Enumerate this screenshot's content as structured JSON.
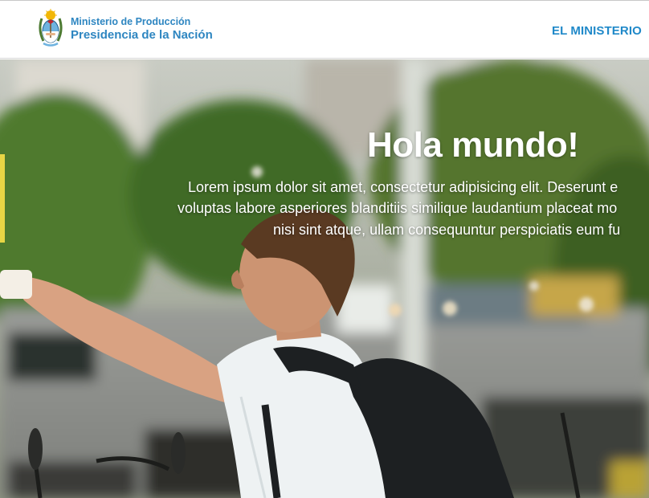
{
  "header": {
    "brand": {
      "line1": "Ministerio de Producción",
      "line2": "Presidencia de la Nación",
      "logo_icon": "argentina-coat-of-arms-icon"
    },
    "nav": {
      "ministerio_label": "EL MINISTERIO"
    }
  },
  "hero": {
    "title": "Hola mundo!",
    "text_lines": [
      "Lorem ipsum dolor sit amet, consectetur adipisicing elit. Deserunt e",
      "voluptas labore asperiores blanditiis similique laudantium placeat mo",
      "nisi sint atque, ullam consequuntur perspiciatis eum fu"
    ]
  },
  "colors": {
    "brand_blue": "#2e86c1",
    "nav_blue": "#2089c9",
    "header_bg": "#ffffff",
    "hero_text": "#ffffff"
  }
}
